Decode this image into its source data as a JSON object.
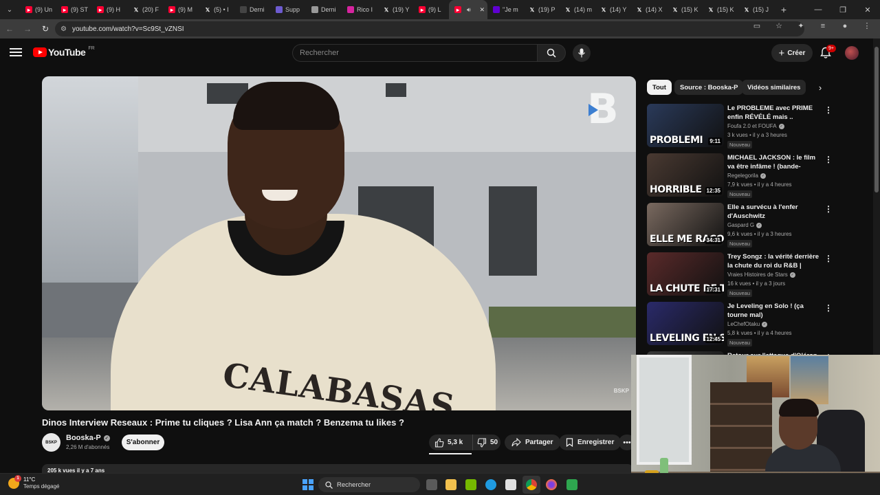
{
  "browser": {
    "tabs": [
      {
        "label": "(9) Un",
        "icon": "youtube-icon",
        "color": "#ff0033"
      },
      {
        "label": "(9) ST",
        "icon": "youtube-icon",
        "color": "#ff0033"
      },
      {
        "label": "(9) H",
        "icon": "youtube-icon",
        "color": "#ff0033"
      },
      {
        "label": "(20) F",
        "icon": "x-icon",
        "color": "#000000"
      },
      {
        "label": "(9) M",
        "icon": "youtube-icon",
        "color": "#ff0033"
      },
      {
        "label": "(5) • I",
        "icon": "x-icon",
        "color": "#000000"
      },
      {
        "label": "Derni",
        "icon": "news-icon",
        "color": "#444444"
      },
      {
        "label": "Supp",
        "icon": "gemini-icon",
        "color": "#6d5bd0"
      },
      {
        "label": "Derni",
        "icon": "doc-icon",
        "color": "#999999"
      },
      {
        "label": "Rico I",
        "icon": "instagram-icon",
        "color": "#d6249f"
      },
      {
        "label": "(19) Y",
        "icon": "x-icon",
        "color": "#000000"
      },
      {
        "label": "(9) L",
        "icon": "youtube-icon",
        "color": "#ff0033"
      },
      {
        "label": "",
        "icon": "youtube-icon",
        "color": "#ff0033",
        "active": true
      },
      {
        "label": "\"Je m",
        "icon": "yahoo-icon",
        "color": "#6001d2"
      },
      {
        "label": "(19) P",
        "icon": "x-icon",
        "color": "#000000"
      },
      {
        "label": "(14) m",
        "icon": "x-icon",
        "color": "#000000"
      },
      {
        "label": "(14) Y",
        "icon": "x-icon",
        "color": "#000000"
      },
      {
        "label": "(14) X",
        "icon": "x-icon",
        "color": "#000000"
      },
      {
        "label": "(15) K",
        "icon": "x-icon",
        "color": "#000000"
      },
      {
        "label": "(15) K",
        "icon": "x-icon",
        "color": "#000000"
      },
      {
        "label": "(15) J",
        "icon": "x-icon",
        "color": "#000000"
      }
    ],
    "new_tab": "+",
    "url": "youtube.com/watch?v=Sc9St_vZNSI"
  },
  "header": {
    "logo_text": "YouTube",
    "country": "FR",
    "search_placeholder": "Rechercher",
    "create_label": "Créer",
    "notifications": "9+"
  },
  "video": {
    "shirt_text": "CALABASAS",
    "watermark": "BSKP",
    "title": "Dinos Interview Reseaux : Prime tu cliques ? Lisa Ann ça match ? Benzema tu likes ?",
    "channel": "Booska-P",
    "channel_avatar": "BSKP",
    "subscribers": "2,26 M d'abonnés",
    "subscribe_label": "S'abonner",
    "likes": "5,3 k",
    "dislikes": "50",
    "share_label": "Partager",
    "save_label": "Enregistrer",
    "desc_preview": "205 k vues  il y a 7 ans"
  },
  "chips": [
    {
      "label": "Tout",
      "active": true
    },
    {
      "label": "Source : Booska-P",
      "active": false
    },
    {
      "label": "Vidéos similaires",
      "active": false
    }
  ],
  "recommendations": [
    {
      "title": "Le PROBLEME avec PRIME enfin RÉVÉLÉ mais ..",
      "channel": "Foufa 2.0  et FOUFA",
      "meta": "3 k vues • il y a 3 heures",
      "badge": "Nouveau",
      "duration": "9:11",
      "thumb_text": "PROBLEMI",
      "thumb_color": "#2a3a5a"
    },
    {
      "title": "MICHAEL JACKSON : le film va être infâme ! (bande-annonce)",
      "channel": "Regelegorila",
      "meta": "7,9 k vues • il y a 4 heures",
      "badge": "Nouveau",
      "duration": "12:35",
      "thumb_text": "HORRIBLE",
      "thumb_color": "#4a3a32"
    },
    {
      "title": "Elle a survécu à l'enfer d'Auschwitz",
      "channel": "Gaspard G",
      "meta": "9,6 k vues • il y a 3 heures",
      "badge": "Nouveau",
      "duration": "34:31",
      "thumb_text": "ELLE ME RACON",
      "thumb_color": "#7a6a60"
    },
    {
      "title": "Trey Songz : la vérité derrière la chute du roi du R&B | Vraies ...",
      "channel": "Vraies Histoires de Stars",
      "meta": "16 k vues • il y a 3 jours",
      "badge": "Nouveau",
      "duration": "17:31",
      "thumb_text": "LA CHUTE DE TREY SC",
      "thumb_color": "#5a2a2a"
    },
    {
      "title": "Je Leveling en Solo ! (ça tourne mal)",
      "channel": "LeChefOtaku",
      "meta": "5,8 k vues • il y a 4 heures",
      "badge": "Nouveau",
      "duration": "12:45",
      "thumb_text": "LEVELING EN SC",
      "thumb_color": "#2a2a6a"
    },
    {
      "title": "Retour sur l'attaque d'Oléron",
      "channel": "",
      "meta": "",
      "badge": "",
      "duration": "",
      "thumb_text": "",
      "thumb_color": "#3a3a3a"
    }
  ],
  "taskbar": {
    "temp": "11°C",
    "weather": "Temps dégagé",
    "search_label": "Rechercher"
  }
}
